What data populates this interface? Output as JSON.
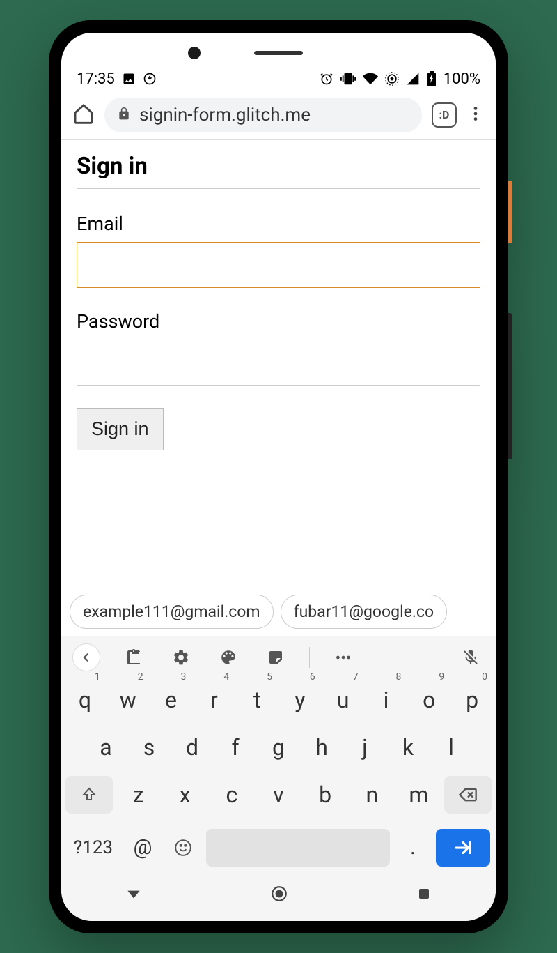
{
  "status_bar": {
    "time": "17:35",
    "battery_text": "100%"
  },
  "browser": {
    "url_text": "signin-form.glitch.me",
    "tab_badge": ":D"
  },
  "form": {
    "title": "Sign in",
    "email_label": "Email",
    "email_value": "",
    "password_label": "Password",
    "password_value": "",
    "signin_button": "Sign in"
  },
  "suggestions": [
    "example111@gmail.com",
    "fubar11@google.co"
  ],
  "keyboard": {
    "symbols_label": "?123",
    "at_label": "@",
    "dot_label": ".",
    "rows": {
      "row1": [
        {
          "k": "q",
          "n": "1"
        },
        {
          "k": "w",
          "n": "2"
        },
        {
          "k": "e",
          "n": "3"
        },
        {
          "k": "r",
          "n": "4"
        },
        {
          "k": "t",
          "n": "5"
        },
        {
          "k": "y",
          "n": "6"
        },
        {
          "k": "u",
          "n": "7"
        },
        {
          "k": "i",
          "n": "8"
        },
        {
          "k": "o",
          "n": "9"
        },
        {
          "k": "p",
          "n": "0"
        }
      ],
      "row2": [
        "a",
        "s",
        "d",
        "f",
        "g",
        "h",
        "j",
        "k",
        "l"
      ],
      "row3": [
        "z",
        "x",
        "c",
        "v",
        "b",
        "n",
        "m"
      ]
    }
  }
}
